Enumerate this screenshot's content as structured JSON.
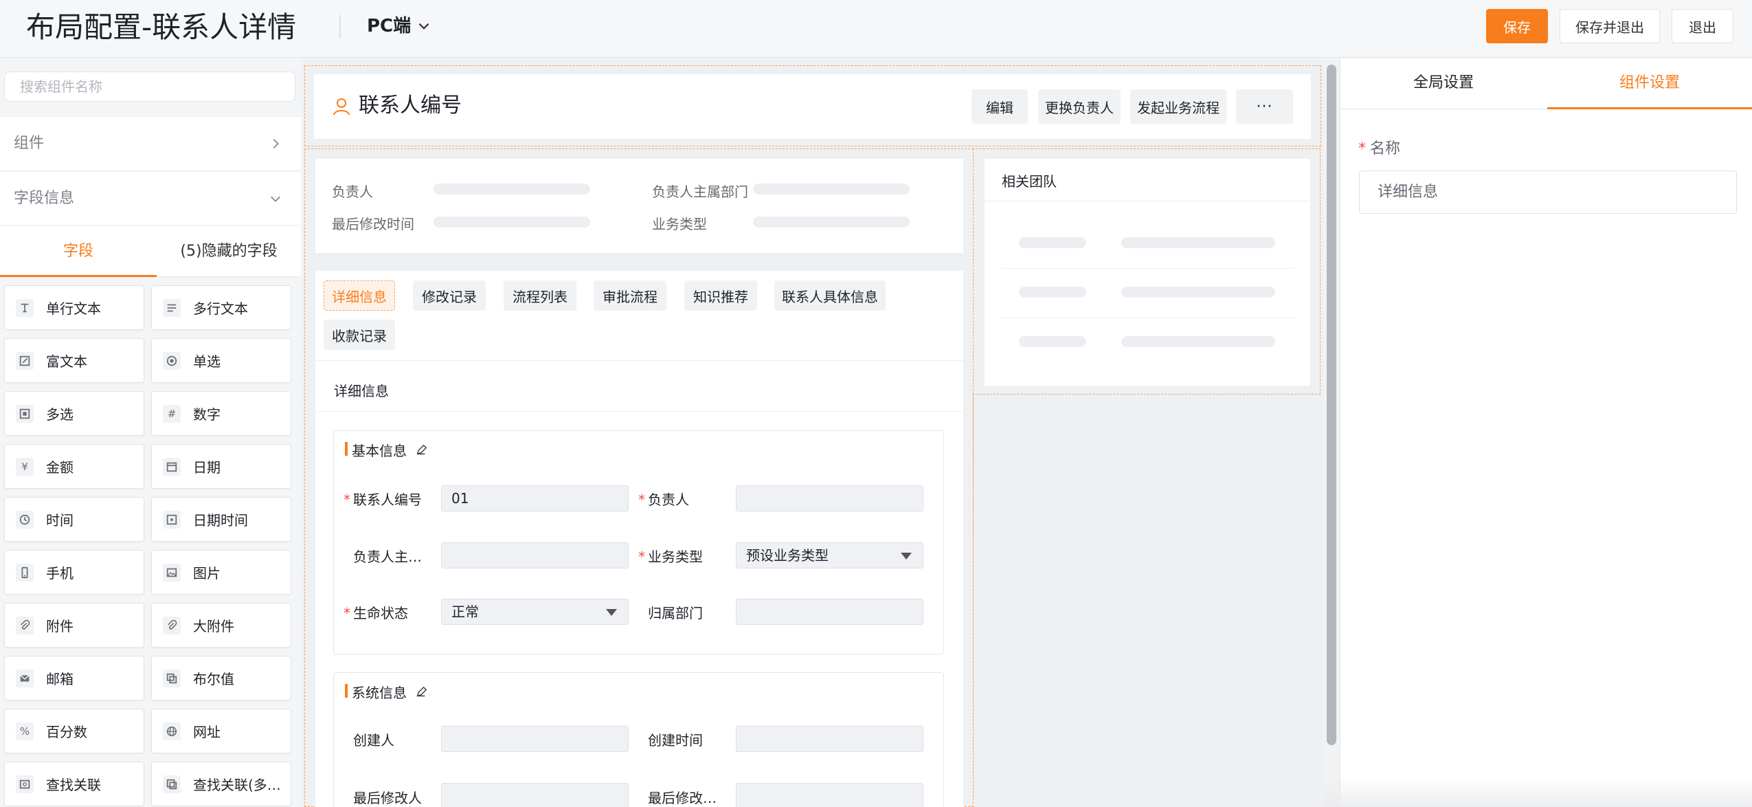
{
  "header": {
    "title": "布局配置-联系人详情",
    "platform": "PC端",
    "buttons": {
      "save": "保存",
      "save_exit": "保存并退出",
      "exit": "退出"
    }
  },
  "left_panel": {
    "search_placeholder": "搜索组件名称",
    "sections": {
      "components": "组件",
      "field_info": "字段信息"
    },
    "tabs": {
      "fields": "字段",
      "hidden": "(5)隐藏的字段"
    },
    "field_types": [
      {
        "label": "单行文本",
        "icon": "text-icon"
      },
      {
        "label": "多行文本",
        "icon": "multiline-text-icon"
      },
      {
        "label": "富文本",
        "icon": "rich-text-icon"
      },
      {
        "label": "单选",
        "icon": "radio-icon"
      },
      {
        "label": "多选",
        "icon": "checkbox-icon"
      },
      {
        "label": "数字",
        "icon": "hash-icon"
      },
      {
        "label": "金额",
        "icon": "yen-icon"
      },
      {
        "label": "日期",
        "icon": "calendar-icon"
      },
      {
        "label": "时间",
        "icon": "clock-icon"
      },
      {
        "label": "日期时间",
        "icon": "datetime-icon"
      },
      {
        "label": "手机",
        "icon": "phone-icon"
      },
      {
        "label": "图片",
        "icon": "image-icon"
      },
      {
        "label": "附件",
        "icon": "paperclip-icon"
      },
      {
        "label": "大附件",
        "icon": "large-attachment-icon"
      },
      {
        "label": "邮箱",
        "icon": "mail-icon"
      },
      {
        "label": "布尔值",
        "icon": "boolean-icon"
      },
      {
        "label": "百分数",
        "icon": "percent-icon"
      },
      {
        "label": "网址",
        "icon": "globe-icon"
      },
      {
        "label": "查找关联",
        "icon": "lookup-icon"
      },
      {
        "label": "查找关联(多…",
        "icon": "lookup-multi-icon"
      }
    ]
  },
  "canvas": {
    "record_title": "联系人编号",
    "header_actions": {
      "edit": "编辑",
      "change_owner": "更换负责人",
      "start_flow": "发起业务流程",
      "more": "···"
    },
    "summary_fields": {
      "owner": "负责人",
      "owner_dept": "负责人主属部门",
      "last_modified": "最后修改时间",
      "biz_type": "业务类型"
    },
    "tabs": [
      "详细信息",
      "修改记录",
      "流程列表",
      "审批流程",
      "知识推荐",
      "联系人具体信息",
      "收款记录"
    ],
    "section_title": "详细信息",
    "basic_group": {
      "title": "基本信息",
      "fields": {
        "contact_code": {
          "label": "联系人编号",
          "value": "01"
        },
        "owner": {
          "label": "负责人",
          "value": ""
        },
        "owner_dept": {
          "label": "负责人主…",
          "value": ""
        },
        "biz_type": {
          "label": "业务类型",
          "value": "预设业务类型"
        },
        "lifecycle": {
          "label": "生命状态",
          "value": "正常"
        },
        "dept": {
          "label": "归属部门",
          "value": ""
        }
      }
    },
    "system_group": {
      "title": "系统信息",
      "fields": {
        "creator": {
          "label": "创建人"
        },
        "created_at": {
          "label": "创建时间"
        },
        "last_modifier": {
          "label": "最后修改人"
        },
        "last_modified_at": {
          "label": "最后修改…"
        }
      }
    },
    "team_card_title": "相关团队"
  },
  "right_panel": {
    "tabs": {
      "global": "全局设置",
      "component": "组件设置"
    },
    "name_label": "名称",
    "name_value": "详细信息"
  },
  "colors": {
    "accent": "#f87d1c",
    "required": "#f54a45"
  }
}
